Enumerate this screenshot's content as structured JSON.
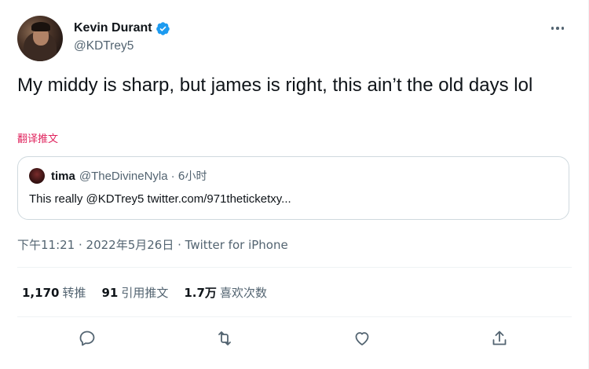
{
  "author": {
    "display_name": "Kevin Durant",
    "handle": "@KDTrey5",
    "verified": true
  },
  "tweet": {
    "text": "My middy is sharp, but james is right, this ain’t the old days lol",
    "translate_label": "翻译推文"
  },
  "quoted_tweet": {
    "name": "tima",
    "handle": "@TheDivineNyla",
    "separator": "·",
    "time": "6小时",
    "text": "This really @KDTrey5 twitter.com/971theticketxy..."
  },
  "meta": {
    "text": "下午11:21 · 2022年5月26日 · Twitter for iPhone"
  },
  "stats": {
    "retweets": {
      "count": "1,170",
      "label": "转推"
    },
    "quotes": {
      "count": "91",
      "label": "引用推文"
    },
    "likes": {
      "count": "1.7万",
      "label": "喜欢次数"
    }
  },
  "actions": {
    "reply_icon": "reply-icon",
    "retweet_icon": "retweet-icon",
    "like_icon": "like-icon",
    "share_icon": "share-icon"
  },
  "colors": {
    "verified": "#1d9bf0",
    "translate_link": "#e0245e",
    "secondary_text": "#536471",
    "border": "#cfd9de"
  }
}
